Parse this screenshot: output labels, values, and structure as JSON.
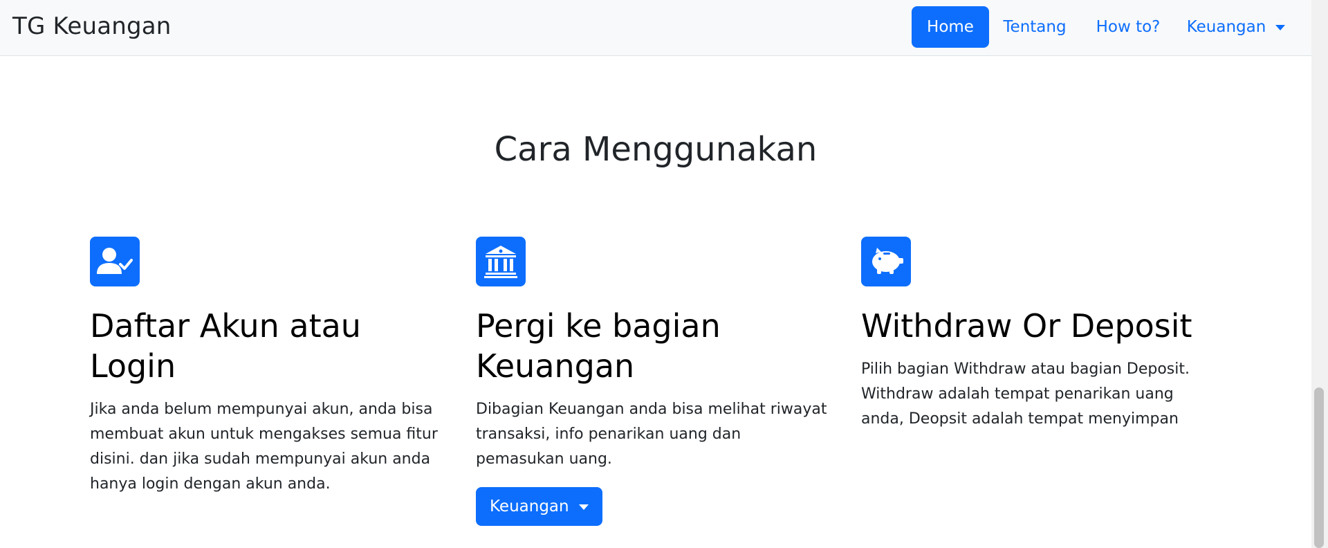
{
  "navbar": {
    "brand": "TG Keuangan",
    "items": [
      {
        "label": "Home",
        "active": true
      },
      {
        "label": "Tentang"
      },
      {
        "label": "How to?"
      },
      {
        "label": "Keuangan"
      }
    ]
  },
  "section": {
    "title": "Cara Menggunakan",
    "features": [
      {
        "icon": "user-check-icon",
        "title": "Daftar Akun atau Login",
        "text": "Jika anda belum mempunyai akun, anda bisa membuat akun untuk mengakses semua fitur disini. dan jika sudah mempunyai akun anda hanya login dengan akun anda."
      },
      {
        "icon": "bank-icon",
        "title": "Pergi ke bagian Keuangan",
        "text": "Dibagian Keuangan anda bisa melihat riwayat transaksi, info penarikan uang dan pemasukan uang.",
        "button": "Keuangan"
      },
      {
        "icon": "piggy-bank-icon",
        "title": "Withdraw Or Deposit",
        "text": "Pilih bagian Withdraw atau bagian Deposit. Withdraw adalah tempat penarikan uang anda, Deopsit adalah tempat menyimpan"
      }
    ]
  },
  "colors": {
    "primary": "#0d6efd",
    "navbar_bg": "#f8f9fa",
    "text": "#212529"
  }
}
